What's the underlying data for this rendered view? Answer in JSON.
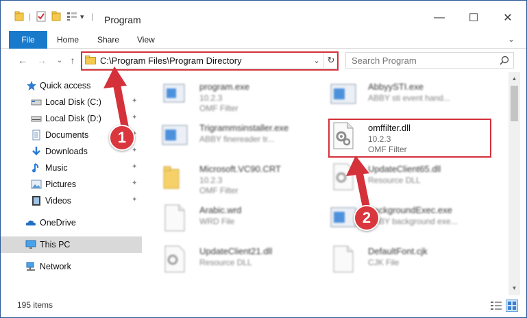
{
  "window": {
    "title": "Program",
    "controls": {
      "minimize": "—",
      "maximize": "☐",
      "close": "✕"
    }
  },
  "ribbon": {
    "tabs": [
      "File",
      "Home",
      "Share",
      "View"
    ],
    "expand_glyph": "⌄"
  },
  "navbar": {
    "back_glyph": "←",
    "forward_glyph": "→",
    "recent_glyph": "⌄",
    "up_glyph": "↑",
    "address": "C:\\Program Files\\Program Directory",
    "address_dropdown_glyph": "⌄",
    "refresh_glyph": "↻",
    "search_placeholder": "Search Program"
  },
  "nav_pane": {
    "items": [
      {
        "label": "Quick access",
        "icon": "star-icon",
        "pinned": false
      },
      {
        "label": "Local Disk (C:)",
        "icon": "drive-icon",
        "pinned": true
      },
      {
        "label": "Local Disk (D:)",
        "icon": "drive-icon",
        "pinned": true
      },
      {
        "label": "Documents",
        "icon": "documents-icon",
        "pinned": true
      },
      {
        "label": "Downloads",
        "icon": "downloads-icon",
        "pinned": true
      },
      {
        "label": "Music",
        "icon": "music-icon",
        "pinned": true
      },
      {
        "label": "Pictures",
        "icon": "pictures-icon",
        "pinned": true
      },
      {
        "label": "Videos",
        "icon": "videos-icon",
        "pinned": true
      },
      {
        "label": "OneDrive",
        "icon": "onedrive-icon",
        "pinned": false
      },
      {
        "label": "This PC",
        "icon": "this-pc-icon",
        "pinned": false,
        "selected": true
      },
      {
        "label": "Network",
        "icon": "network-icon",
        "pinned": false
      }
    ],
    "pin_glyph": "📌"
  },
  "files": [
    {
      "name": "program.exe",
      "line1": "10.2.3",
      "line2": "OMF Filter",
      "icon": "exe-icon"
    },
    {
      "name": "AbbyySTI.exe",
      "line1": "ABBY sti event hand...",
      "line2": "",
      "icon": "exe-icon"
    },
    {
      "name": "Trigrammsinstaller.exe",
      "line1": "ABBY finereader tr...",
      "line2": "",
      "icon": "exe-icon"
    },
    {
      "name": "omffilter.dll",
      "line1": "10.2.3",
      "line2": "OMF Filter",
      "icon": "dll-gear-icon"
    },
    {
      "name": "Microsoft.VC90.CRT",
      "line1": "10.2.3",
      "line2": "OMF Filter",
      "icon": "folder-icon"
    },
    {
      "name": "UpdateClient65.dll",
      "line1": "Resource DLL",
      "line2": "",
      "icon": "dll-gear-icon"
    },
    {
      "name": "Arabic.wrd",
      "line1": "WRD File",
      "line2": "",
      "icon": "blank-file-icon"
    },
    {
      "name": "BackgroundExec.exe",
      "line1": "ABBY background exe...",
      "line2": "",
      "icon": "exe-icon"
    },
    {
      "name": "UpdateClient21.dll",
      "line1": "Resource DLL",
      "line2": "",
      "icon": "dll-gear-icon"
    },
    {
      "name": "DefaultFont.cjk",
      "line1": "CJK File",
      "line2": "",
      "icon": "blank-file-icon"
    }
  ],
  "status": {
    "item_count": "195 items"
  },
  "annotations": {
    "callout_1": "1",
    "callout_2": "2",
    "highlight_color": "#d4313b"
  },
  "colors": {
    "file_tab": "#1979ca",
    "selection": "#d9d9d9",
    "callout": "#d9363e"
  }
}
